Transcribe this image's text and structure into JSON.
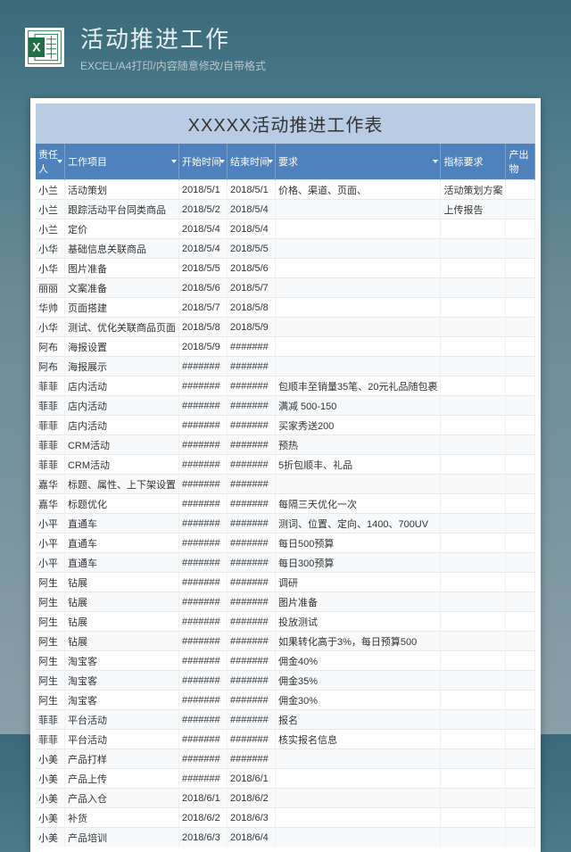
{
  "header": {
    "title": "活动推进工作",
    "subtitle": "EXCEL/A4打印/内容随意修改/自带格式",
    "icon": "excel-icon"
  },
  "sheet": {
    "title": "XXXXX活动推进工作表",
    "columns": [
      "责任人",
      "工作项目",
      "开始时间",
      "结束时间",
      "要求",
      "指标要求",
      "产出物"
    ],
    "rows": [
      [
        "小兰",
        "活动策划",
        "2018/5/1",
        "2018/5/1",
        "价格、渠道、页面、",
        "活动策划方案",
        ""
      ],
      [
        "小兰",
        "跟踪活动平台同类商品",
        "2018/5/2",
        "2018/5/4",
        "",
        "上传报告",
        ""
      ],
      [
        "小兰",
        "定价",
        "2018/5/4",
        "2018/5/4",
        "",
        "",
        ""
      ],
      [
        "小华",
        "基础信息关联商品",
        "2018/5/4",
        "2018/5/5",
        "",
        "",
        ""
      ],
      [
        "小华",
        "图片准备",
        "2018/5/5",
        "2018/5/6",
        "",
        "",
        ""
      ],
      [
        "丽丽",
        "文案准备",
        "2018/5/6",
        "2018/5/7",
        "",
        "",
        ""
      ],
      [
        "华帅",
        "页面搭建",
        "2018/5/7",
        "2018/5/8",
        "",
        "",
        ""
      ],
      [
        "小华",
        "测试、优化关联商品页面",
        "2018/5/8",
        "2018/5/9",
        "",
        "",
        ""
      ],
      [
        "阿布",
        "海报设置",
        "2018/5/9",
        "#######",
        "",
        "",
        ""
      ],
      [
        "阿布",
        "海报展示",
        "#######",
        "#######",
        "",
        "",
        ""
      ],
      [
        "菲菲",
        "店内活动",
        "#######",
        "#######",
        "包顺丰至销量35笔、20元礼品随包裹",
        "",
        ""
      ],
      [
        "菲菲",
        "店内活动",
        "#######",
        "#######",
        "满减 500-150",
        "",
        ""
      ],
      [
        "菲菲",
        "店内活动",
        "#######",
        "#######",
        "买家秀送200",
        "",
        ""
      ],
      [
        "菲菲",
        "CRM活动",
        "#######",
        "#######",
        "预热",
        "",
        ""
      ],
      [
        "菲菲",
        "CRM活动",
        "#######",
        "#######",
        "5折包顺丰、礼品",
        "",
        ""
      ],
      [
        "嘉华",
        "标题、属性、上下架设置",
        "#######",
        "#######",
        "",
        "",
        ""
      ],
      [
        "嘉华",
        "标题优化",
        "#######",
        "#######",
        "每隔三天优化一次",
        "",
        ""
      ],
      [
        "小平",
        "直通车",
        "#######",
        "#######",
        "测词、位置、定向、1400、700UV",
        "",
        ""
      ],
      [
        "小平",
        "直通车",
        "#######",
        "#######",
        "每日500预算",
        "",
        ""
      ],
      [
        "小平",
        "直通车",
        "#######",
        "#######",
        "每日300预算",
        "",
        ""
      ],
      [
        "阿生",
        "钻展",
        "#######",
        "#######",
        "调研",
        "",
        ""
      ],
      [
        "阿生",
        "钻展",
        "#######",
        "#######",
        "图片准备",
        "",
        ""
      ],
      [
        "阿生",
        "钻展",
        "#######",
        "#######",
        "投放测试",
        "",
        ""
      ],
      [
        "阿生",
        "钻展",
        "#######",
        "#######",
        "如果转化高于3%，每日预算500",
        "",
        ""
      ],
      [
        "阿生",
        "淘宝客",
        "#######",
        "#######",
        "佣金40%",
        "",
        ""
      ],
      [
        "阿生",
        "淘宝客",
        "#######",
        "#######",
        "佣金35%",
        "",
        ""
      ],
      [
        "阿生",
        "淘宝客",
        "#######",
        "#######",
        "佣金30%",
        "",
        ""
      ],
      [
        "菲菲",
        "平台活动",
        "#######",
        "#######",
        "报名",
        "",
        ""
      ],
      [
        "菲菲",
        "平台活动",
        "#######",
        "#######",
        "核实报名信息",
        "",
        ""
      ],
      [
        "小美",
        "产品打样",
        "#######",
        "#######",
        "",
        "",
        ""
      ],
      [
        "小美",
        "产品上传",
        "#######",
        "2018/6/1",
        "",
        "",
        ""
      ],
      [
        "小美",
        "产品入仓",
        "2018/6/1",
        "2018/6/2",
        "",
        "",
        ""
      ],
      [
        "小美",
        "补货",
        "2018/6/2",
        "2018/6/3",
        "",
        "",
        ""
      ],
      [
        "小美",
        "产品培训",
        "2018/6/3",
        "2018/6/4",
        "",
        "",
        ""
      ]
    ]
  }
}
